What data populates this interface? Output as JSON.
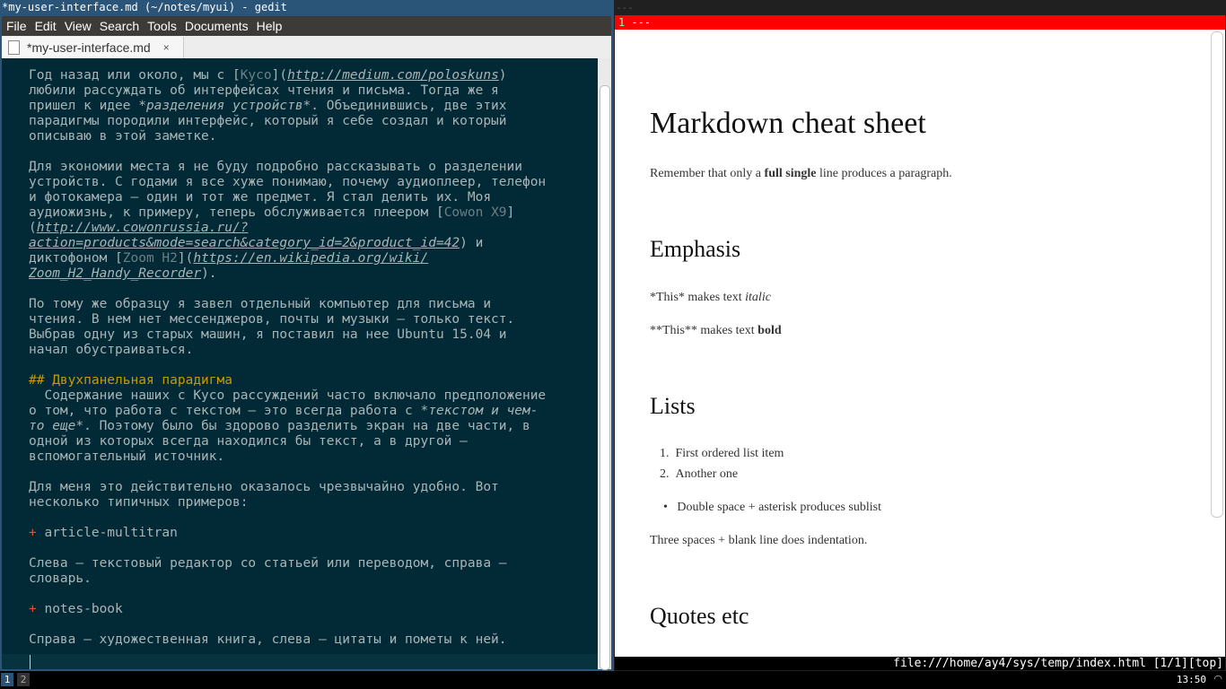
{
  "gedit": {
    "title": "*my-user-interface.md (~/notes/myui) - gedit",
    "menu": [
      "File",
      "Edit",
      "View",
      "Search",
      "Tools",
      "Documents",
      "Help"
    ],
    "tab": {
      "label": "*my-user-interface.md",
      "close": "×"
    },
    "lines": [
      [
        {
          "t": "Год назад или около, мы с ["
        },
        {
          "t": "Кусо",
          "c": "lt"
        },
        {
          "t": "]("
        },
        {
          "t": "http://medium.com/poloskuns",
          "c": "url"
        },
        {
          "t": ")"
        }
      ],
      [
        {
          "t": "любили рассуждать об интерфейсах чтения и письма. Тогда же я"
        }
      ],
      [
        {
          "t": "пришел к идее "
        },
        {
          "t": "*разделения устройств",
          "c": "it"
        },
        {
          "t": "*. Объединившись, две этих"
        }
      ],
      [
        {
          "t": "парадигмы породили интерфейс, который я себе создал и который"
        }
      ],
      [
        {
          "t": "описываю в этой заметке."
        }
      ],
      [],
      [
        {
          "t": "Для экономии места я не буду подробно рассказывать о разделении"
        }
      ],
      [
        {
          "t": "устройств. С годами я все хуже понимаю, почему аудиоплеер, телефон"
        }
      ],
      [
        {
          "t": "и фотокамера — один и тот же предмет. Я стал делить их. Моя"
        }
      ],
      [
        {
          "t": "аудиожизнь, к примеру, теперь обслуживается плеером ["
        },
        {
          "t": "Cowon X9",
          "c": "lt"
        },
        {
          "t": "]"
        }
      ],
      [
        {
          "t": "("
        },
        {
          "t": "http://www.cowonrussia.ru/?",
          "c": "url"
        }
      ],
      [
        {
          "t": "action=products&mode=search&category_id=2&product_id=42",
          "c": "url"
        },
        {
          "t": ") и"
        }
      ],
      [
        {
          "t": "диктофоном ["
        },
        {
          "t": "Zoom H2",
          "c": "lt"
        },
        {
          "t": "]("
        },
        {
          "t": "https://en.wikipedia.org/wiki/",
          "c": "url"
        }
      ],
      [
        {
          "t": "Zoom_H2_Handy_Recorder",
          "c": "url"
        },
        {
          "t": ")."
        }
      ],
      [],
      [
        {
          "t": "По тому же образцу я завел отдельный компьютер для письма и"
        }
      ],
      [
        {
          "t": "чтения. В нем нет мессенджеров, почты и музыки — только текст."
        }
      ],
      [
        {
          "t": "Выбрав одну из старых машин, я поставил на нее Ubuntu 15.04 и"
        }
      ],
      [
        {
          "t": "начал обустраиваться."
        }
      ],
      [],
      [
        {
          "t": "## Двухпанельная парадигма",
          "c": "hd"
        }
      ],
      [
        {
          "t": "  Содержание наших с Кусо рассуждений часто включало предположение"
        }
      ],
      [
        {
          "t": "о том, что работа с текстом — это всегда работа с "
        },
        {
          "t": "*текстом и чем-",
          "c": "it"
        }
      ],
      [
        {
          "t": "то еще",
          "c": "it"
        },
        {
          "t": "*. Поэтому было бы здорово разделить экран на две части, в"
        }
      ],
      [
        {
          "t": "одной из которых всегда находился бы текст, а в другой —"
        }
      ],
      [
        {
          "t": "вспомогательный источник."
        }
      ],
      [],
      [
        {
          "t": "Для меня это действительно оказалось чрезвычайно удобно. Вот"
        }
      ],
      [
        {
          "t": "несколько типичных примеров:"
        }
      ],
      [],
      [
        {
          "t": "+",
          "c": "bl"
        },
        {
          "t": " article-multitran"
        }
      ],
      [],
      [
        {
          "t": "Слева — текстовый редактор со статьей или переводом, справа —"
        }
      ],
      [
        {
          "t": "словарь."
        }
      ],
      [],
      [
        {
          "t": "+",
          "c": "bl"
        },
        {
          "t": " notes-book"
        }
      ],
      [],
      [
        {
          "t": "Справа — художественная книга, слева — цитаты и пометы к ней."
        }
      ]
    ]
  },
  "browser": {
    "title": "---",
    "line_number": "1",
    "line_text": "---",
    "h1": "Markdown cheat sheet",
    "intro": {
      "a": "Remember that only a ",
      "b": "full single",
      "c": " line produces a paragraph."
    },
    "emphasis": {
      "title": "Emphasis",
      "l1a": "*This* makes text ",
      "l1b": "italic",
      "l2a": "**This** makes text ",
      "l2b": "bold"
    },
    "lists": {
      "title": "Lists",
      "ol": [
        "First ordered list item",
        "Another one"
      ],
      "ul": [
        "Double space + asterisk produces sublist"
      ],
      "note": "Three spaces + blank line does indentation."
    },
    "quotes": {
      "title": "Quotes etc"
    },
    "status": "file:///home/ay4/sys/temp/index.html [1/1][top]"
  },
  "taskbar": {
    "workspaces": [
      "1",
      "2"
    ],
    "active": "1",
    "clock": "13:50"
  }
}
